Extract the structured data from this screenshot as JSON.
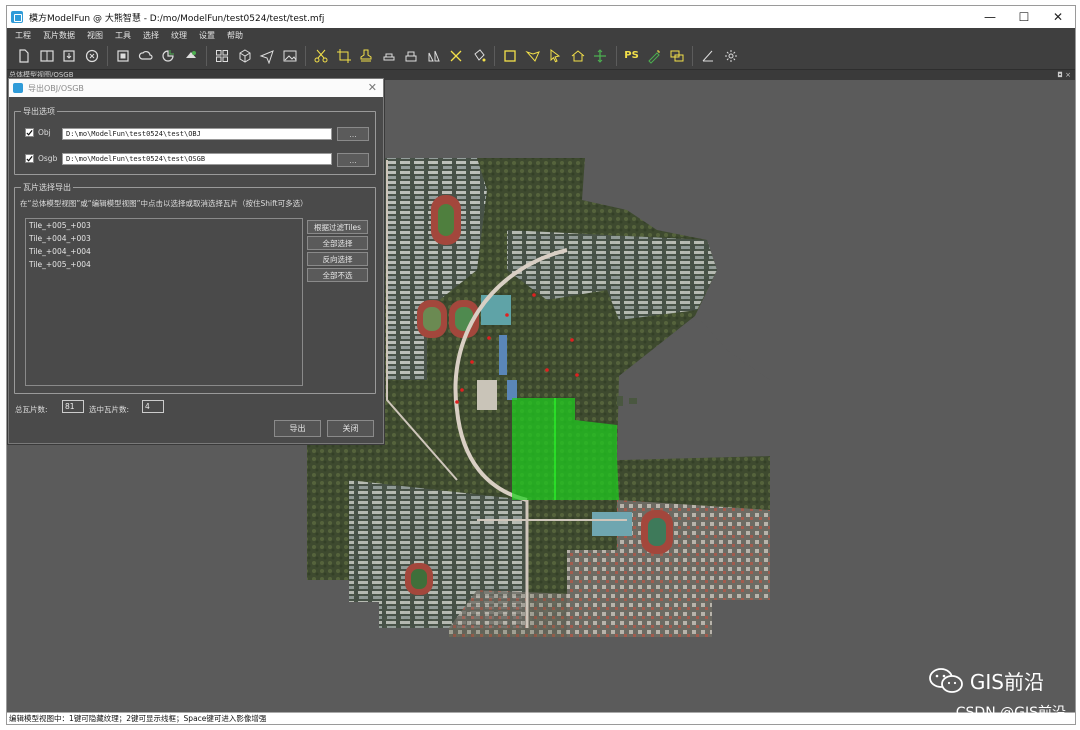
{
  "window": {
    "title": "模方ModelFun @ 大熊智慧 - D:/mo/ModelFun/test0524/test/test.mfj",
    "controls": {
      "minimize": "—",
      "maximize": "☐",
      "close": "✕"
    }
  },
  "menu": [
    "工程",
    "瓦片数据",
    "视图",
    "工具",
    "选择",
    "纹理",
    "设置",
    "帮助"
  ],
  "toolbar": {
    "groups": [
      [
        "new-file-icon",
        "open-split-icon",
        "import-icon",
        "close-circle-icon"
      ],
      [
        "stop-square-icon",
        "cloud-icon",
        "model-pie-icon",
        "render-icon"
      ],
      [
        "grid-icon",
        "cube-icon",
        "plane-icon",
        "image-icon"
      ],
      [
        "scissors-icon",
        "crop-icon",
        "stamp-icon",
        "eraser-icon",
        "print-icon",
        "flip-icon",
        "mirror-x-icon",
        "bucket-icon"
      ],
      [
        "select-rect-icon",
        "select-poly-icon",
        "pointer-icon",
        "home-icon",
        "move-icon"
      ],
      [
        "ps-icon",
        "magic-icon",
        "layers-icon"
      ],
      [
        "angle-icon",
        "settings-icon"
      ]
    ],
    "ps_label": "PS"
  },
  "view": {
    "header": "总体模型视图/OSGB",
    "float_label": "◘ ×"
  },
  "dialog": {
    "title": "导出OBJ/OSGB",
    "close": "✕",
    "export_options": {
      "title": "导出选项",
      "rows": [
        {
          "label": "Obj",
          "path": "D:\\mo\\ModelFun\\test0524\\test\\OBJ",
          "checked": true,
          "browse": "..."
        },
        {
          "label": "Osgb",
          "path": "D:\\mo\\ModelFun\\test0524\\test\\OSGB",
          "checked": true,
          "browse": "..."
        }
      ]
    },
    "tile_select": {
      "title": "瓦片选择导出",
      "hint": "在“总体模型视图”或“编辑模型视图”中点击以选择或取消选择瓦片（按住Shift可多选）",
      "tiles": [
        "Tile_+005_+003",
        "Tile_+004_+003",
        "Tile_+004_+004",
        "Tile_+005_+004"
      ],
      "buttons": [
        "根据过滤Tiles",
        "全部选择",
        "反向选择",
        "全部不选"
      ]
    },
    "totals": {
      "total_label": "总瓦片数:",
      "total_value": "81",
      "selected_label": "选中瓦片数:",
      "selected_value": "4"
    },
    "actions": {
      "export": "导出",
      "close": "关闭"
    }
  },
  "status": "编辑模型视图中：1键可隐藏纹理；2键可显示线框；Space键可进入影像增强",
  "watermark": {
    "brand": "GIS前沿",
    "source": "CSDN @GIS前沿"
  },
  "colors": {
    "accent": "#2f9bd8",
    "selection_green": "#1fcf1f",
    "panel": "#4a4a4a",
    "viewport": "#5b5b5b"
  }
}
